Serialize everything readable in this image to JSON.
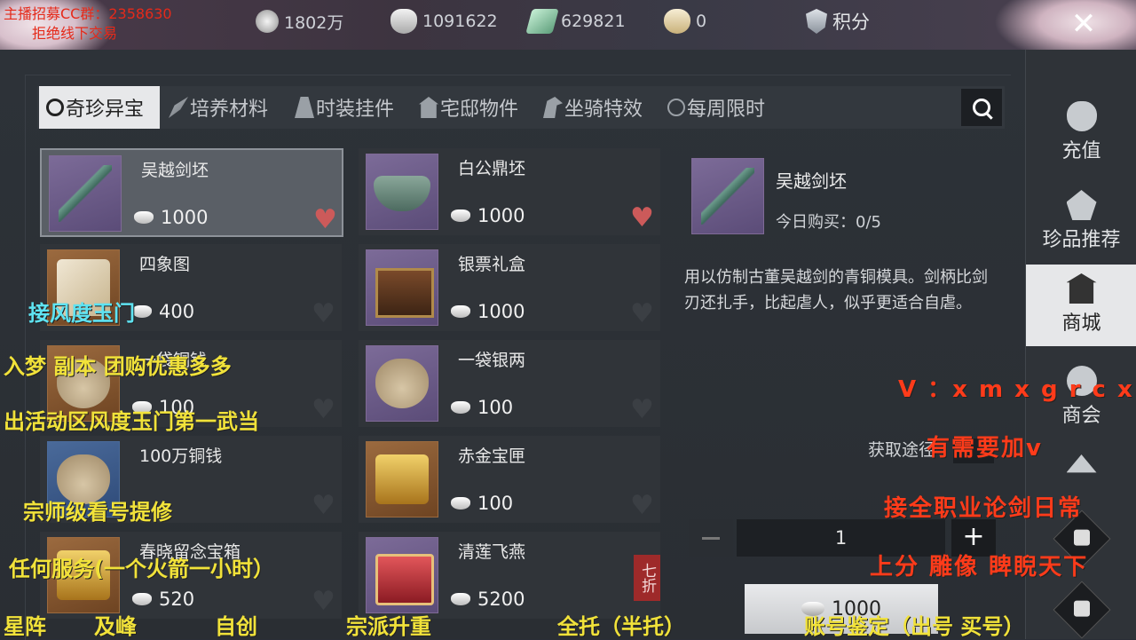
{
  "topbar": {
    "currencies": [
      {
        "icon": "coin-icon",
        "value": "1802万"
      },
      {
        "icon": "silver-ingot-icon",
        "value": "1091622"
      },
      {
        "icon": "jade-icon",
        "value": "629821"
      },
      {
        "icon": "ticket-bag-icon",
        "value": "0"
      }
    ],
    "points_label": "积分",
    "close_label": "✕"
  },
  "tabs": [
    {
      "label": "奇珍异宝",
      "icon": "magnifier-icon",
      "active": true
    },
    {
      "label": "培养材料",
      "icon": "feather-icon"
    },
    {
      "label": "时装挂件",
      "icon": "robe-icon"
    },
    {
      "label": "宅邸物件",
      "icon": "house-icon"
    },
    {
      "label": "坐骑特效",
      "icon": "horse-icon"
    },
    {
      "label": "每周限时",
      "icon": "timer-icon"
    }
  ],
  "items": [
    {
      "name": "吴越剑坯",
      "price": "1000",
      "favorite": true
    },
    {
      "name": "白公鼎坯",
      "price": "1000",
      "favorite": true
    },
    {
      "name": "四象图",
      "price": "400",
      "favorite": false
    },
    {
      "name": "银票礼盒",
      "price": "1000",
      "favorite": false
    },
    {
      "name": "一袋铜钱",
      "price": "100",
      "favorite": false
    },
    {
      "name": "一袋银两",
      "price": "100",
      "favorite": false
    },
    {
      "name": "100万铜钱",
      "price": "",
      "favorite": false
    },
    {
      "name": "赤金宝匣",
      "price": "100",
      "favorite": false
    },
    {
      "name": "春晓留念宝箱",
      "price": "520",
      "favorite": false
    },
    {
      "name": "清莲飞燕",
      "price": "5200",
      "favorite": false,
      "discount": "七折"
    }
  ],
  "detail": {
    "name": "吴越剑坯",
    "limit": "今日购买：0/5",
    "description": "用以仿制古董吴越剑的青铜模具。剑柄比剑刃还扎手，比起虐人，似乎更适合自虐。",
    "obtain_label": "获取途径",
    "quantity": "1",
    "buy_price": "1000"
  },
  "right_nav": [
    {
      "label": "充值",
      "icon": "money-bag-icon"
    },
    {
      "label": "珍品推荐",
      "icon": "gem-icon"
    },
    {
      "label": "商城",
      "icon": "shop-icon",
      "active": true
    },
    {
      "label": "商会",
      "icon": "guild-icon"
    }
  ],
  "overlays": {
    "red_top_1": "主播招募CC群：2358630",
    "red_top_2": "拒绝线下交易",
    "cyan_1": "接风度玉门",
    "yellow_1": "入梦  副本  团购优惠多多",
    "yellow_2": "出活动区风度玉门第一武当",
    "yellow_3": "宗师级看号提修",
    "yellow_4": "任何服务(一个火箭一小时）",
    "bottom_1": "星阵",
    "bottom_2": "及峰",
    "bottom_3": "自创",
    "bottom_4": "宗派升重",
    "bottom_5": "全托（半托）",
    "bottom_6": "账号鉴定（出号 买号）",
    "orange_1": "V ：x m x g r c x",
    "orange_2": "有需要加v",
    "orange_3": "接全职业论剑日常",
    "orange_4": "上分   雕像   睥睨天下"
  }
}
